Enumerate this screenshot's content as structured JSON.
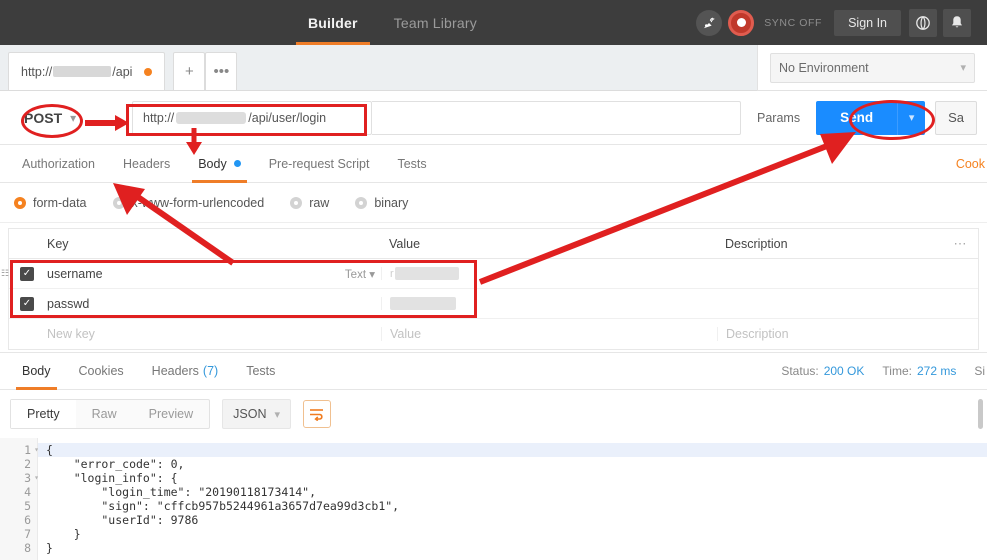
{
  "topbar": {
    "nav": [
      {
        "label": "Builder",
        "active": true
      },
      {
        "label": "Team Library",
        "active": false
      }
    ],
    "dish_icon": "satellite-dish-icon",
    "sync_icon": "sync-circle-icon",
    "sync_label": "SYNC OFF",
    "signin_label": "Sign In",
    "globe_icon": "globe-icon",
    "bell_icon": "bell-icon",
    "background": "#3d3d3d",
    "accent": "#ef7d28"
  },
  "tabstrip": {
    "tab_url_prefix": "http://",
    "tab_url_suffix": "/api",
    "unsaved_dot": true,
    "new_tab_label": "+",
    "more_label": "•••"
  },
  "environment": {
    "selected": "No Environment",
    "chevron_icon": "chevron-down-icon"
  },
  "request": {
    "method": "POST",
    "method_chevron_icon": "chevron-down-icon",
    "url_prefix": "http://",
    "url_suffix": "/api/user/login",
    "params_label": "Params",
    "send_label": "Send",
    "send_chevron_icon": "chevron-down-icon",
    "save_label": "Sa",
    "send_color": "#1a8cff"
  },
  "request_tabs": [
    {
      "label": "Authorization",
      "active": false,
      "dot": false
    },
    {
      "label": "Headers",
      "active": false,
      "dot": false
    },
    {
      "label": "Body",
      "active": true,
      "dot": true
    },
    {
      "label": "Pre-request Script",
      "active": false,
      "dot": false
    },
    {
      "label": "Tests",
      "active": false,
      "dot": false
    }
  ],
  "cookies_link": "Cook",
  "body_types": [
    {
      "label": "form-data",
      "selected": true
    },
    {
      "label": "x-www-form-urlencoded",
      "selected": false
    },
    {
      "label": "raw",
      "selected": false
    },
    {
      "label": "binary",
      "selected": false
    }
  ],
  "kv_table": {
    "columns": [
      "Key",
      "Value",
      "Description"
    ],
    "more_icon": "ellipsis-icon",
    "rows": [
      {
        "checked": true,
        "key": "username",
        "type": "Text",
        "value_redacted": true,
        "description": ""
      },
      {
        "checked": true,
        "key": "passwd",
        "type": "",
        "value_redacted": true,
        "description": ""
      }
    ],
    "new_row": {
      "key_placeholder": "New key",
      "value_placeholder": "Value",
      "description_placeholder": "Description"
    }
  },
  "response": {
    "tabs": [
      {
        "label": "Body",
        "active": true,
        "count": ""
      },
      {
        "label": "Cookies",
        "active": false,
        "count": ""
      },
      {
        "label": "Headers",
        "active": false,
        "count": "(7)"
      },
      {
        "label": "Tests",
        "active": false,
        "count": ""
      }
    ],
    "status_label": "Status:",
    "status_value": "200 OK",
    "time_label": "Time:",
    "time_value": "272 ms",
    "size_label": "Si"
  },
  "viewer": {
    "modes": [
      {
        "label": "Pretty",
        "active": true
      },
      {
        "label": "Raw",
        "active": false
      },
      {
        "label": "Preview",
        "active": false
      }
    ],
    "format": "JSON",
    "format_chevron_icon": "chevron-down-icon",
    "wrap_icon": "wrap-lines-icon"
  },
  "code": {
    "lines": [
      {
        "n": "1",
        "fold": true,
        "text": "{",
        "highlight": true
      },
      {
        "n": "2",
        "fold": false,
        "text": "    \"error_code\": 0,",
        "highlight": false
      },
      {
        "n": "3",
        "fold": true,
        "text": "    \"login_info\": {",
        "highlight": false
      },
      {
        "n": "4",
        "fold": false,
        "text": "        \"login_time\": \"20190118173414\",",
        "highlight": false
      },
      {
        "n": "5",
        "fold": false,
        "text": "        \"sign\": \"cffcb957b5244961a3657d7ea99d3cb1\",",
        "highlight": false
      },
      {
        "n": "6",
        "fold": false,
        "text": "        \"userId\": 9786",
        "highlight": false
      },
      {
        "n": "7",
        "fold": false,
        "text": "    }",
        "highlight": false
      },
      {
        "n": "8",
        "fold": false,
        "text": "}",
        "highlight": false
      }
    ]
  },
  "annotations": {
    "color": "#e02020",
    "items": [
      "post-method-ellipse",
      "url-field-rect",
      "send-button-ellipse",
      "body-tab-arrow",
      "key-column-arrow",
      "method-to-url-arrow",
      "value-to-send-arrow",
      "kv-rows-rect"
    ]
  }
}
